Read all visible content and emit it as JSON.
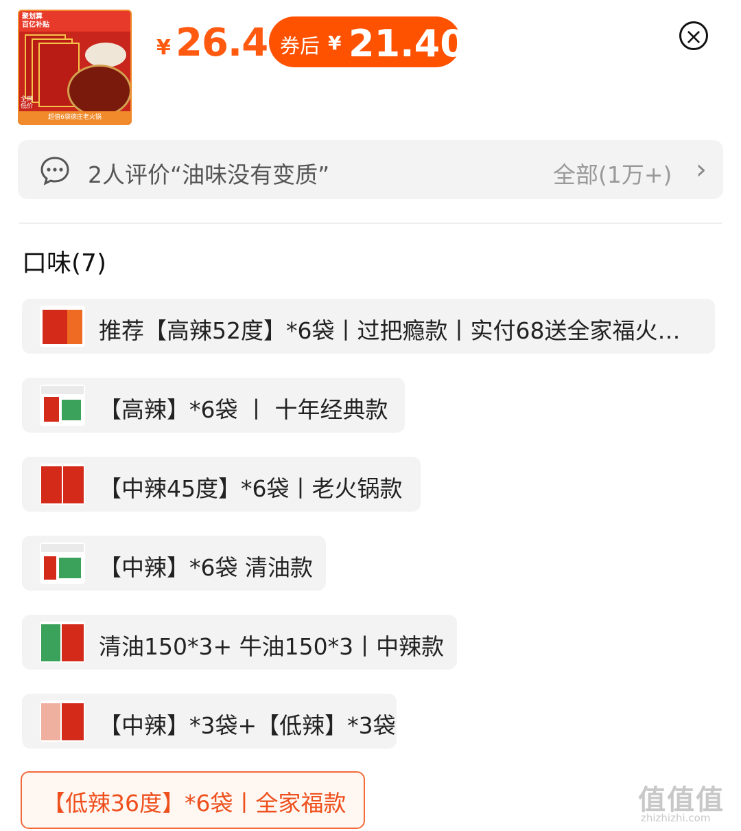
{
  "product": {
    "thumbnail_icon": "hotpot-product-image",
    "thumb_mark": "聚划算\n百亿补贴",
    "thumb_lowprice": "全网\n低价",
    "thumb_banner": "超值6袋德庄老火锅",
    "price_currency": "¥",
    "price": "26.4",
    "coupon_label": "券后",
    "coupon_currency": "¥",
    "coupon_price": "21.40"
  },
  "close_button": {
    "icon": "close-circle-icon",
    "glyph": "×"
  },
  "review_bar": {
    "icon": "chat-bubble-icon",
    "text": "2人评价“油味没有变质”",
    "all_label": "全部(1万+)",
    "chevron": "›"
  },
  "section": {
    "title": "口味(7)"
  },
  "options": [
    {
      "label": "推荐【高辣52度】*6袋丨过把瘾款丨实付68送全家福火…",
      "selected": false,
      "has_image": true
    },
    {
      "label": "【高辣】*6袋 丨 十年经典款",
      "selected": false,
      "has_image": true
    },
    {
      "label": "【中辣45度】*6袋丨老火锅款",
      "selected": false,
      "has_image": true
    },
    {
      "label": "【中辣】*6袋 清油款",
      "selected": false,
      "has_image": true
    },
    {
      "label": "清油150*3+ 牛油150*3丨中辣款",
      "selected": false,
      "has_image": true
    },
    {
      "label": "【中辣】*3袋+【低辣】*3袋",
      "selected": false,
      "has_image": true
    },
    {
      "label": "【低辣36度】*6袋丨全家福款",
      "selected": true,
      "has_image": false
    }
  ],
  "watermark": {
    "big": "值值值",
    "small": "zhizhizhi.com"
  },
  "colors": {
    "accent": "#ff5200",
    "price": "#ff5a10",
    "selected_border": "#f26a3a",
    "chip_bg": "#f3f3f3"
  }
}
